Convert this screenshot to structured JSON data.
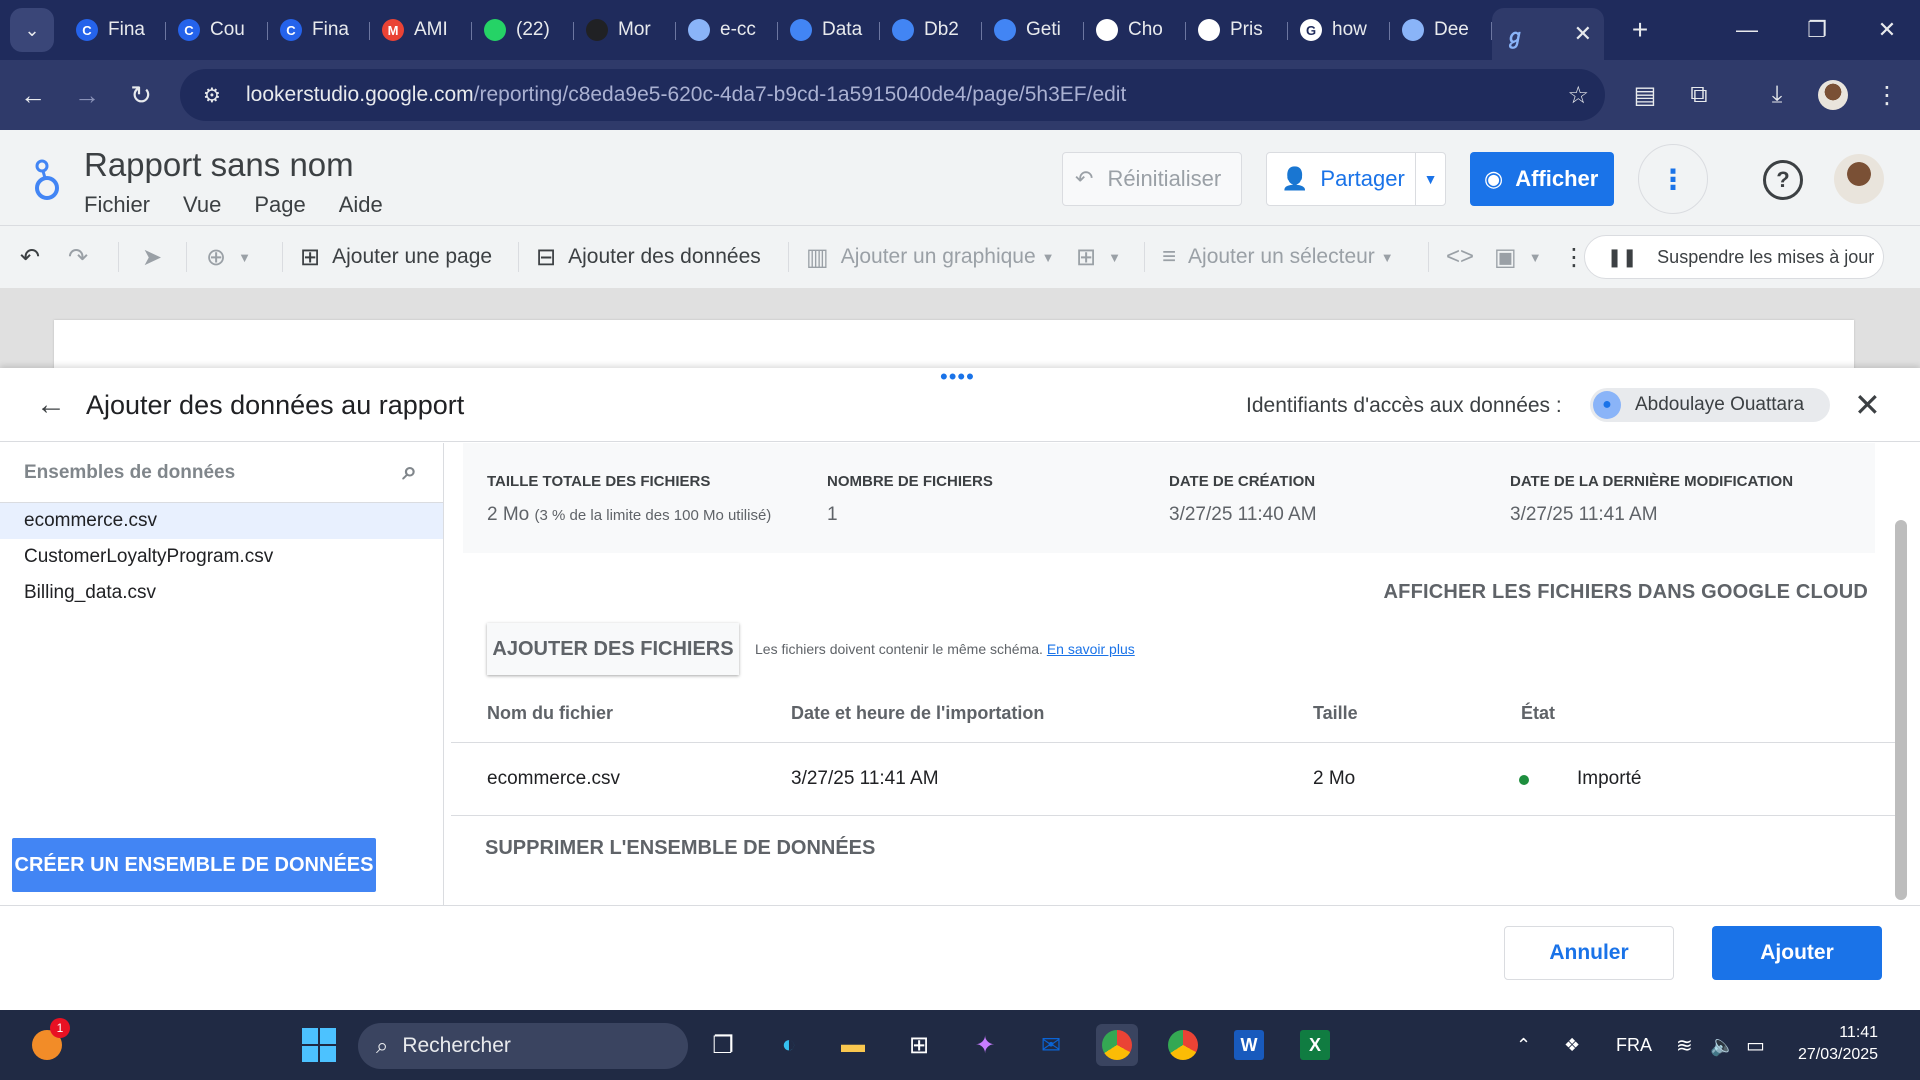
{
  "browser": {
    "tabs": [
      {
        "label": "Fina",
        "icon": "canva-icon",
        "color": "#2563eb"
      },
      {
        "label": "Cou",
        "icon": "canva-icon",
        "color": "#2563eb"
      },
      {
        "label": "Fina",
        "icon": "canva-icon",
        "color": "#2563eb"
      },
      {
        "label": "AMI",
        "icon": "gmail-icon",
        "color": "#ea4335"
      },
      {
        "label": "(22)",
        "icon": "whatsapp-icon",
        "color": "#25d366"
      },
      {
        "label": "Mor",
        "icon": "spider-icon",
        "color": "#202124"
      },
      {
        "label": "e-cc",
        "icon": "list-icon",
        "color": "#8ab4f8"
      },
      {
        "label": "Data",
        "icon": "cloud-icon",
        "color": "#4285f4"
      },
      {
        "label": "Db2",
        "icon": "cloud-icon",
        "color": "#4285f4"
      },
      {
        "label": "Geti",
        "icon": "cloud-icon",
        "color": "#4285f4"
      },
      {
        "label": "Cho",
        "icon": "github-icon",
        "color": "#ffffff"
      },
      {
        "label": "Pris",
        "icon": "openai-icon",
        "color": "#ffffff"
      },
      {
        "label": "how",
        "icon": "google-icon",
        "color": "#ffffff"
      },
      {
        "label": "Dee",
        "icon": "arrow-icon",
        "color": "#8ab4f8"
      }
    ],
    "active_tab": {
      "icon": "looker-icon"
    },
    "url_host": "lookerstudio.google.com",
    "url_path": "/reporting/c8eda9e5-620c-4da7-b9cd-1a5915040de4/page/5h3EF/edit"
  },
  "header": {
    "title": "Rapport sans nom",
    "menu": [
      "Fichier",
      "Vue",
      "Page",
      "Aide"
    ],
    "reset": "Réinitialiser",
    "share": "Partager",
    "view": "Afficher"
  },
  "toolbar": {
    "add_page": "Ajouter une page",
    "add_data": "Ajouter des données",
    "add_chart": "Ajouter un graphique",
    "add_selector": "Ajouter un sélecteur",
    "suspend": "Suspendre les mises à jour"
  },
  "panel": {
    "title": "Ajouter des données au rapport",
    "credentials_label": "Identifiants d'accès aux données :",
    "credentials_user": "Abdoulaye Ouattara",
    "datasets_placeholder": "Ensembles de données",
    "datasets": [
      "ecommerce.csv",
      "CustomerLoyaltyProgram.csv",
      "Billing_data.csv"
    ],
    "create_dataset": "CRÉER UN ENSEMBLE DE DONNÉES",
    "info": {
      "total_size_label": "TAILLE TOTALE DES FICHIERS",
      "total_size_value": "2 Mo",
      "total_size_note": "(3 % de la limite des 100 Mo utilisé)",
      "file_count_label": "NOMBRE DE FICHIERS",
      "file_count_value": "1",
      "created_label": "DATE DE CRÉATION",
      "created_value": "3/27/25 11:40 AM",
      "modified_label": "DATE DE LA DERNIÈRE MODIFICATION",
      "modified_value": "3/27/25 11:41 AM"
    },
    "view_gcloud": "AFFICHER LES FICHIERS DANS GOOGLE CLOUD",
    "add_files": "AJOUTER DES FICHIERS",
    "hint": "Les fichiers doivent contenir le même schéma.",
    "learn_more": "En savoir plus",
    "table_headers": {
      "name": "Nom du fichier",
      "date": "Date et heure de l'importation",
      "size": "Taille",
      "state": "État"
    },
    "row": {
      "name": "ecommerce.csv",
      "date": "3/27/25 11:41 AM",
      "size": "2 Mo",
      "state": "Importé"
    },
    "delete_dataset": "SUPPRIMER L'ENSEMBLE DE DONNÉES",
    "cancel": "Annuler",
    "add": "Ajouter"
  },
  "taskbar": {
    "search": "Rechercher",
    "lang": "FRA",
    "time": "11:41",
    "date": "27/03/2025",
    "notif_count": "1"
  },
  "colors": {
    "accent": "#1a73e8",
    "status_ok": "#1e8e3e"
  }
}
